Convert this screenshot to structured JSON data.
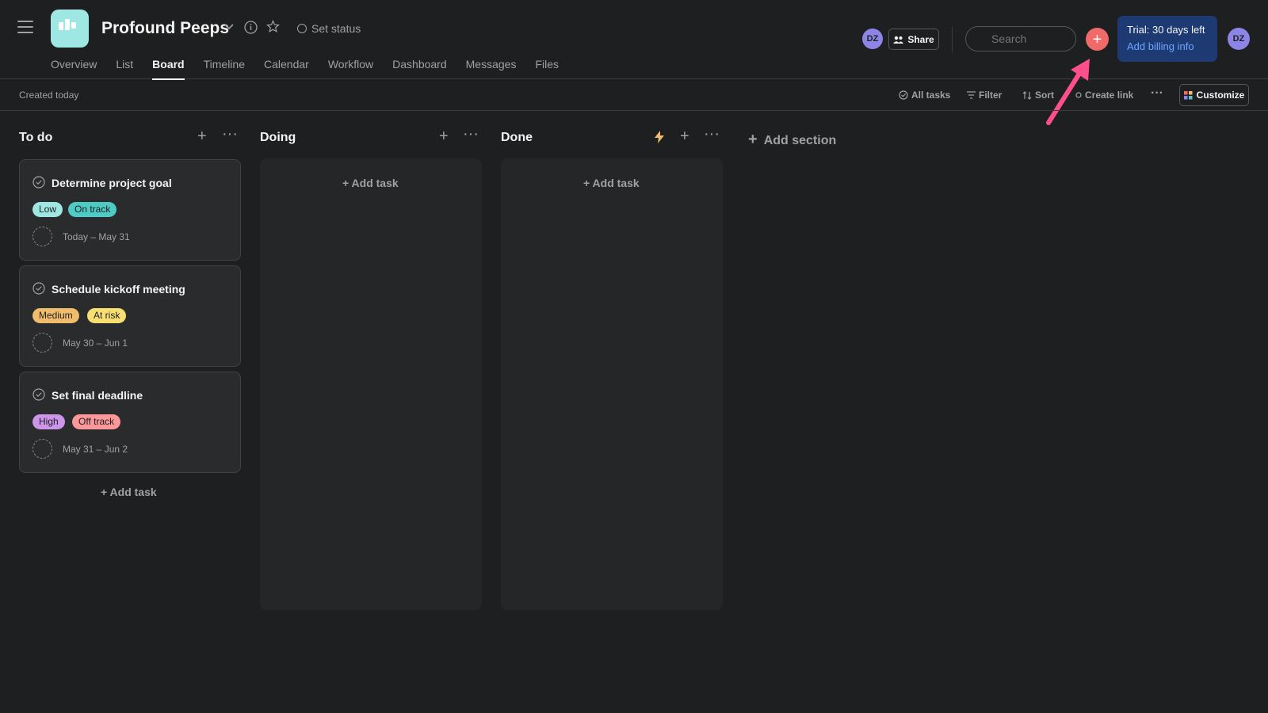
{
  "header": {
    "project_title": "Profound Peeps",
    "set_status": "Set status",
    "tabs": [
      {
        "label": "Overview"
      },
      {
        "label": "List"
      },
      {
        "label": "Board"
      },
      {
        "label": "Timeline"
      },
      {
        "label": "Calendar"
      },
      {
        "label": "Workflow"
      },
      {
        "label": "Dashboard"
      },
      {
        "label": "Messages"
      },
      {
        "label": "Files"
      }
    ],
    "active_tab": "Board",
    "avatar_initials": "DZ",
    "share_label": "Share",
    "search_placeholder": "Search",
    "add_button_glyph": "+",
    "trial": {
      "title": "Trial: 30 days left",
      "link": "Add billing info"
    }
  },
  "toolbar": {
    "created": "Created today",
    "all_tasks": "All tasks",
    "filter": "Filter",
    "sort": "Sort",
    "create_link": "Create link",
    "more": "···",
    "customize": "Customize"
  },
  "board": {
    "columns": [
      {
        "title": "To do",
        "add_task": "+ Add task"
      },
      {
        "title": "Doing",
        "add_task": "+ Add task"
      },
      {
        "title": "Done",
        "add_task": "+ Add task"
      }
    ],
    "add_section": "Add section",
    "cards": [
      {
        "name": "Determine project goal",
        "priority": "Low",
        "status": "On track",
        "dates": "Today – May 31"
      },
      {
        "name": "Schedule kickoff meeting",
        "priority": "Medium",
        "status": "At risk",
        "dates": "May 30 – Jun 1"
      },
      {
        "name": "Set final deadline",
        "priority": "High",
        "status": "Off track",
        "dates": "May 31 – Jun 2"
      }
    ]
  },
  "colors": {
    "background": "#1e1f21",
    "accent_add": "#f06a6a",
    "low": "#9ee7e3",
    "on_track": "#4ecbc4",
    "medium": "#f1bd6c",
    "at_risk": "#f8df72",
    "high": "#cd95ea",
    "off_track": "#fc979a",
    "annotation_arrow": "#ff4f8b"
  }
}
